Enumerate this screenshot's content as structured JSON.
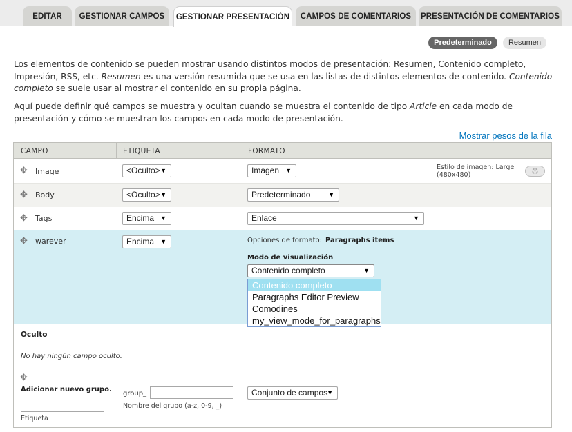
{
  "tabs": [
    "EDITAR",
    "GESTIONAR CAMPOS",
    "GESTIONAR PRESENTACIÓN",
    "CAMPOS DE COMENTARIOS",
    "PRESENTACIÓN DE COMENTARIOS"
  ],
  "view_modes": {
    "active": "Predeterminado",
    "inactive": "Resumen"
  },
  "intro": {
    "p1_a": "Los elementos de contenido se pueden mostrar usando distintos modos de presentación: Resumen, Contenido completo, Impresión, RSS, etc. ",
    "p1_em1": "Resumen",
    "p1_b": " es una versión resumida que se usa en las listas de distintos elementos de contenido. ",
    "p1_em2": "Contenido completo",
    "p1_c": " se suele usar al mostrar el contenido en su propia página.",
    "p2_a": "Aquí puede definir qué campos se muestra y ocultan cuando se muestra el contenido de tipo ",
    "p2_em": "Article",
    "p2_b": " en cada modo de presentación y cómo se muestran los campos en cada modo de presentación."
  },
  "weights_link": "Mostrar pesos de la fila",
  "table": {
    "headers": [
      "CAMPO",
      "ETIQUETA",
      "FORMATO"
    ],
    "rows": [
      {
        "field": "Image",
        "label": "<Oculto>",
        "format": "Imagen",
        "summary": "Estilo de imagen: Large (480x480)"
      },
      {
        "field": "Body",
        "label": "<Oculto>",
        "format": "Predeterminado"
      },
      {
        "field": "Tags",
        "label": "Encima",
        "format": "Enlace"
      },
      {
        "field": "warever",
        "label": "Encima",
        "format_options_label": "Opciones de formato:",
        "format_options_value": "Paragraphs items",
        "view_mode_label": "Modo de visualización",
        "view_mode_value": "Contenido completo"
      }
    ],
    "dropdown_options": [
      "Contenido completo",
      "Paragraphs Editor Preview",
      "Comodines",
      "my_view_mode_for_paragraphs"
    ],
    "hidden_title": "Oculto",
    "hidden_empty": "No hay ningún campo oculto.",
    "add_group": {
      "title": "Adicionar nuevo grupo.",
      "label_hint": "Etiqueta",
      "prefix": "group_",
      "name_hint": "Nombre del grupo (a-z, 0-9, _)",
      "type": "Conjunto de campos"
    }
  }
}
